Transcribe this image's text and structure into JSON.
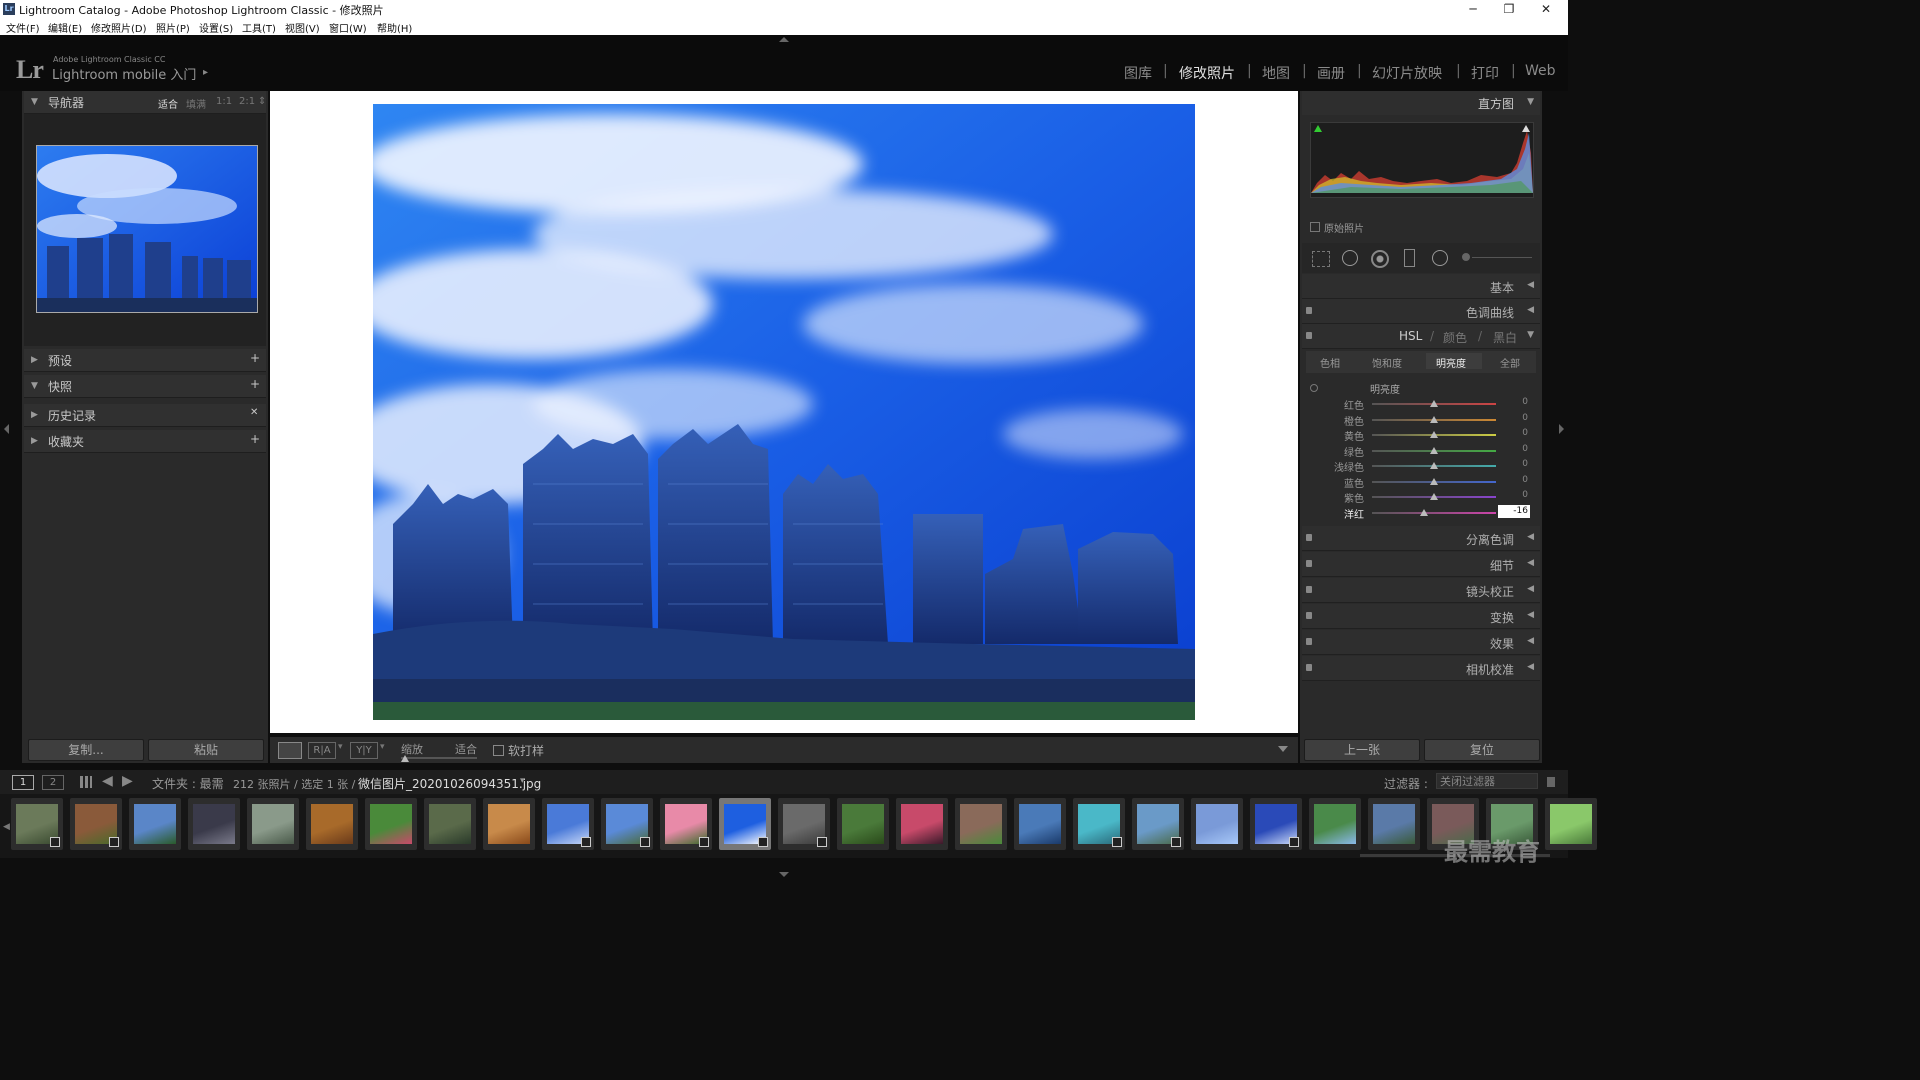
{
  "window": {
    "title": "Lightroom Catalog - Adobe Photoshop Lightroom Classic - 修改照片",
    "app_icon": "Lr",
    "controls": [
      "─",
      "❐",
      "✕"
    ]
  },
  "menu": [
    "文件(F)",
    "编辑(E)",
    "修改照片(D)",
    "照片(P)",
    "设置(S)",
    "工具(T)",
    "视图(V)",
    "窗口(W)",
    "帮助(H)"
  ],
  "identity": {
    "logo": "Lr",
    "product": "Adobe Lightroom Classic CC",
    "mobile": "Lightroom mobile 入门",
    "arrow": "▸"
  },
  "modules": [
    "图库",
    "修改照片",
    "地图",
    "画册",
    "幻灯片放映",
    "打印",
    "Web"
  ],
  "module_separator": "|",
  "navigator": {
    "title": "导航器",
    "zoom_options": [
      "适合",
      "填满",
      "1:1",
      "2:1"
    ],
    "zoom_more": "⇕"
  },
  "left_sections": [
    {
      "title": "预设",
      "action": "+",
      "expanded": false
    },
    {
      "title": "快照",
      "action": "+",
      "expanded": true
    },
    {
      "title": "历史记录",
      "action": "✕",
      "expanded": false
    },
    {
      "title": "收藏夹",
      "action": "+",
      "expanded": false
    }
  ],
  "left_buttons": {
    "copy": "复制...",
    "paste": "粘贴"
  },
  "toolbar": {
    "zoom_label": "缩放",
    "zoom_value": "适合",
    "soft_proof": "软打样",
    "view_ra": "R|A",
    "view_yy": "Y|Y"
  },
  "histogram": {
    "title": "直方图",
    "original_photo": "原始照片"
  },
  "right_sections": {
    "basic": "基本",
    "tone_curve": "色调曲线",
    "hsl_tabs": [
      "HSL",
      "颜色",
      "黑白"
    ],
    "hsl_sep": "/",
    "split_toning": "分离色调",
    "detail": "细节",
    "lens": "镜头校正",
    "transform": "变换",
    "effects": "效果",
    "calibration": "相机校准"
  },
  "hsl": {
    "subtabs": [
      "色相",
      "饱和度",
      "明亮度",
      "全部"
    ],
    "active_subtab": "明亮度",
    "group_title": "明亮度",
    "rows": [
      {
        "label": "红色",
        "value": "0",
        "color": "#c44"
      },
      {
        "label": "橙色",
        "value": "0",
        "color": "#c83"
      },
      {
        "label": "黄色",
        "value": "0",
        "color": "#cc4"
      },
      {
        "label": "绿色",
        "value": "0",
        "color": "#4a4"
      },
      {
        "label": "浅绿色",
        "value": "0",
        "color": "#4aa"
      },
      {
        "label": "蓝色",
        "value": "0",
        "color": "#46c"
      },
      {
        "label": "紫色",
        "value": "0",
        "color": "#84c"
      },
      {
        "label": "洋红",
        "value": "-16",
        "color": "#c4a"
      }
    ],
    "row_values": [
      0,
      0,
      0,
      0,
      0,
      0,
      0,
      -16
    ]
  },
  "right_buttons": {
    "prev": "上一张",
    "reset": "复位"
  },
  "filmbar": {
    "pages": [
      "1",
      "2"
    ],
    "source": "文件夹 : 最需",
    "count": "212 张照片 / 选定 1 张 /",
    "filename": "微信图片_20201026094351.jpg",
    "filter_label": "过滤器 :",
    "filter_value": "关闭过滤器"
  },
  "watermark": "最需教育",
  "colors": {
    "sky_blue": "#1e5fe0",
    "panel_bg": "#2a2a2a",
    "accent_white": "#e0e0e0"
  },
  "icons": [
    "grid-icon",
    "back-arrow-icon",
    "forward-arrow-icon",
    "crop-icon",
    "spot-removal-icon",
    "red-eye-icon",
    "graduated-filter-icon",
    "radial-filter-icon",
    "brush-icon"
  ]
}
